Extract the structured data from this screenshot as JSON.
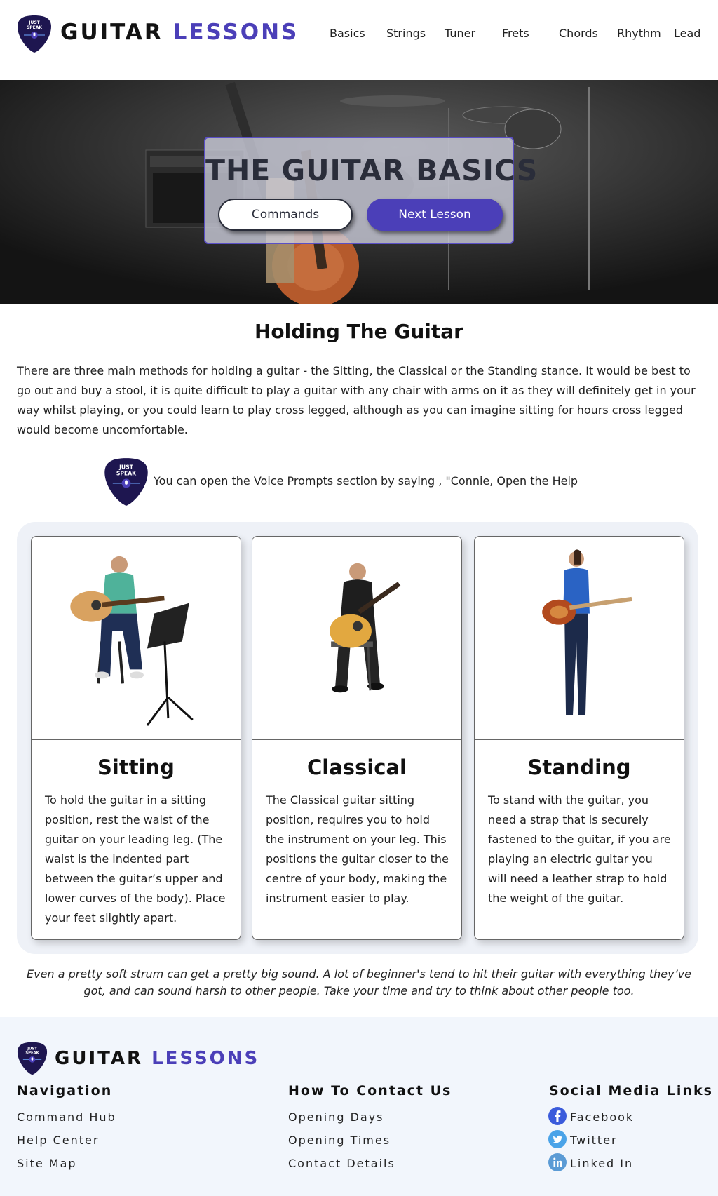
{
  "header": {
    "logo_text_line1": "JUST",
    "logo_text_line2": "SPEAK",
    "brand_word1": "GUITAR",
    "brand_word2": "LESSONS",
    "nav": [
      "Basics",
      "Strings",
      "Tuner",
      "Frets",
      "Chords",
      "Rhythm",
      "Lead"
    ],
    "active_nav": "Basics"
  },
  "hero": {
    "title": "THE GUITAR BASICS",
    "commands_label": "Commands",
    "next_label": "Next Lesson"
  },
  "main": {
    "title": "Holding The Guitar",
    "intro": "There are three main methods for holding a guitar - the Sitting, the Classical or the Standing stance. It would be best to go out and buy a stool, it is quite difficult to play a guitar with any chair with arms on it as they will definitely get in your way whilst playing, or you could learn to play cross legged, although as you can imagine sitting for hours cross legged would become uncomfortable.",
    "voice_tip": "You can open the Voice Prompts section by saying , \"Connie, Open the Help",
    "cards": [
      {
        "title": "Sitting",
        "body": "To hold the guitar in a sitting position, rest the waist of the guitar on your leading leg. (The waist is the indented part between the guitar’s upper and lower curves of the body). Place your feet slightly apart."
      },
      {
        "title": "Classical",
        "body": "The Classical guitar sitting position, requires you to hold the instrument on your leg. This positions the guitar closer to the centre of your body, making the instrument easier to play."
      },
      {
        "title": "Standing",
        "body": "To stand with the guitar, you need a strap that is securely fastened to the guitar, if you are playing an electric guitar you will need a leather strap to hold the weight of the guitar."
      }
    ],
    "quote": "Even a pretty soft strum can get a pretty big sound. A lot of beginner's tend to hit their guitar with everything they’ve got, and can sound harsh to other people. Take your time and try to think about other people too."
  },
  "footer": {
    "brand_word1": "GUITAR",
    "brand_word2": "LESSONS",
    "nav_heading": "Navigation",
    "nav_links": [
      "Command Hub",
      "Help Center",
      "Site Map"
    ],
    "contact_heading": "How To Contact Us",
    "contact_links": [
      "Opening Days",
      "Opening Times",
      "Contact Details"
    ],
    "social_heading": "Social Media Links",
    "social_links": [
      {
        "label": "Facebook",
        "icon": "facebook-icon"
      },
      {
        "label": "Twitter",
        "icon": "twitter-icon"
      },
      {
        "label": "Linked In",
        "icon": "linkedin-icon"
      }
    ]
  },
  "colors": {
    "accent": "#4b3fb8",
    "logo_dark": "#1e1650",
    "footer_bg": "#f2f6fc",
    "cards_bg": "#eef1f7"
  }
}
